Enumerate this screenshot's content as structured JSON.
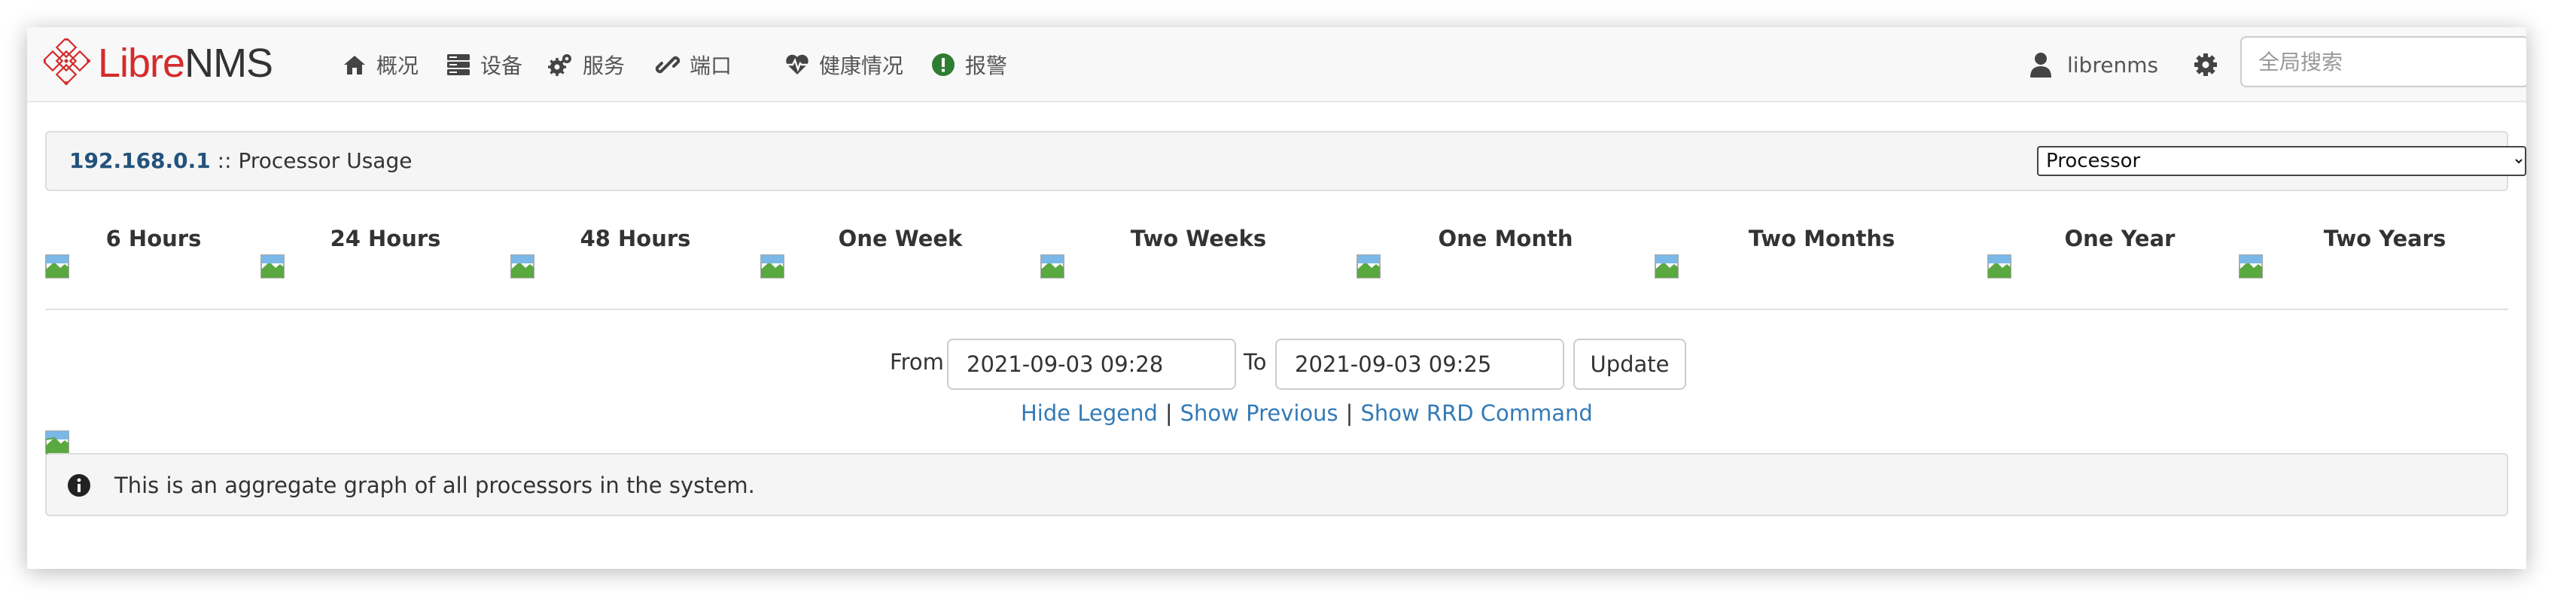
{
  "navbar": {
    "brand_libre": "Libre",
    "brand_nms": "NMS",
    "items": [
      {
        "label": "概况",
        "icon": "home-icon"
      },
      {
        "label": "设备",
        "icon": "server-icon"
      },
      {
        "label": "服务",
        "icon": "cogs-icon"
      },
      {
        "label": "端口",
        "icon": "link-icon"
      },
      {
        "label": "健康情况",
        "icon": "heartbeat-icon"
      },
      {
        "label": "报警",
        "icon": "alert-icon"
      }
    ],
    "user": "librenms",
    "search_placeholder": "全局搜索",
    "colors": {
      "brand_red": "#d52b2b",
      "alert_green": "#2e7d32"
    }
  },
  "header": {
    "host": "192.168.0.1",
    "separator": " :: ",
    "title": "Processor Usage",
    "select_value": "Processor"
  },
  "periods": [
    "6 Hours",
    "24 Hours",
    "48 Hours",
    "One Week",
    "Two Weeks",
    "One Month",
    "Two Months",
    "One Year",
    "Two Years"
  ],
  "range_form": {
    "from_label": "From",
    "from_value": "2021-09-03 09:28",
    "to_label": "To",
    "to_value": "2021-09-03 09:25",
    "update_label": "Update"
  },
  "links": {
    "hide_legend": "Hide Legend",
    "show_previous": "Show Previous",
    "show_rrd": "Show RRD Command",
    "separator": "|"
  },
  "info": {
    "text": "This is an aggregate graph of all processors in the system."
  }
}
